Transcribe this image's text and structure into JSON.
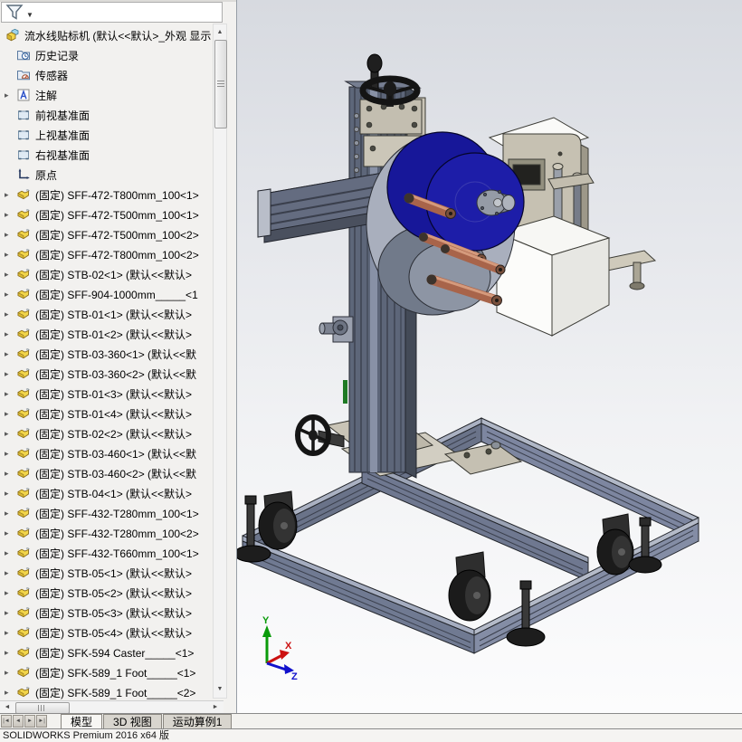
{
  "feature_tree": {
    "filter_tooltip": "过滤",
    "items": [
      {
        "icon": "assembly",
        "label": "流水线贴标机 (默认<<默认>_外观 显示",
        "indent": 0,
        "expandable": false
      },
      {
        "icon": "history",
        "label": "历史记录",
        "indent": 1,
        "expandable": false
      },
      {
        "icon": "sensor",
        "label": "传感器",
        "indent": 1,
        "expandable": false
      },
      {
        "icon": "annotation",
        "label": "注解",
        "indent": 1,
        "expandable": true
      },
      {
        "icon": "plane",
        "label": "前视基准面",
        "indent": 1,
        "expandable": false
      },
      {
        "icon": "plane",
        "label": "上视基准面",
        "indent": 1,
        "expandable": false
      },
      {
        "icon": "plane",
        "label": "右视基准面",
        "indent": 1,
        "expandable": false
      },
      {
        "icon": "origin",
        "label": "原点",
        "indent": 1,
        "expandable": false
      },
      {
        "icon": "part",
        "label": "(固定) SFF-472-T800mm_100<1>",
        "indent": 1,
        "expandable": true
      },
      {
        "icon": "part",
        "label": "(固定) SFF-472-T500mm_100<1>",
        "indent": 1,
        "expandable": true
      },
      {
        "icon": "part",
        "label": "(固定) SFF-472-T500mm_100<2>",
        "indent": 1,
        "expandable": true
      },
      {
        "icon": "part",
        "label": "(固定) SFF-472-T800mm_100<2>",
        "indent": 1,
        "expandable": true
      },
      {
        "icon": "part",
        "label": "(固定) STB-02<1> (默认<<默认>",
        "indent": 1,
        "expandable": true
      },
      {
        "icon": "part",
        "label": "(固定) SFF-904-1000mm_____<1",
        "indent": 1,
        "expandable": true
      },
      {
        "icon": "part",
        "label": "(固定) STB-01<1> (默认<<默认>",
        "indent": 1,
        "expandable": true
      },
      {
        "icon": "part",
        "label": "(固定) STB-01<2> (默认<<默认>",
        "indent": 1,
        "expandable": true
      },
      {
        "icon": "part",
        "label": "(固定) STB-03-360<1> (默认<<默",
        "indent": 1,
        "expandable": true
      },
      {
        "icon": "part",
        "label": "(固定) STB-03-360<2> (默认<<默",
        "indent": 1,
        "expandable": true
      },
      {
        "icon": "part",
        "label": "(固定) STB-01<3> (默认<<默认>",
        "indent": 1,
        "expandable": true
      },
      {
        "icon": "part",
        "label": "(固定) STB-01<4> (默认<<默认>",
        "indent": 1,
        "expandable": true
      },
      {
        "icon": "part",
        "label": "(固定) STB-02<2> (默认<<默认>",
        "indent": 1,
        "expandable": true
      },
      {
        "icon": "part",
        "label": "(固定) STB-03-460<1> (默认<<默",
        "indent": 1,
        "expandable": true
      },
      {
        "icon": "part",
        "label": "(固定) STB-03-460<2> (默认<<默",
        "indent": 1,
        "expandable": true
      },
      {
        "icon": "part",
        "label": "(固定) STB-04<1> (默认<<默认>",
        "indent": 1,
        "expandable": true
      },
      {
        "icon": "part",
        "label": "(固定) SFF-432-T280mm_100<1>",
        "indent": 1,
        "expandable": true
      },
      {
        "icon": "part",
        "label": "(固定) SFF-432-T280mm_100<2>",
        "indent": 1,
        "expandable": true
      },
      {
        "icon": "part",
        "label": "(固定) SFF-432-T660mm_100<1>",
        "indent": 1,
        "expandable": true
      },
      {
        "icon": "part",
        "label": "(固定) STB-05<1> (默认<<默认>",
        "indent": 1,
        "expandable": true
      },
      {
        "icon": "part",
        "label": "(固定) STB-05<2> (默认<<默认>",
        "indent": 1,
        "expandable": true
      },
      {
        "icon": "part",
        "label": "(固定) STB-05<3> (默认<<默认>",
        "indent": 1,
        "expandable": true
      },
      {
        "icon": "part",
        "label": "(固定) STB-05<4> (默认<<默认>",
        "indent": 1,
        "expandable": true
      },
      {
        "icon": "part",
        "label": "(固定) SFK-594 Caster_____<1>",
        "indent": 1,
        "expandable": true
      },
      {
        "icon": "part",
        "label": "(固定) SFK-589_1 Foot_____<1>",
        "indent": 1,
        "expandable": true
      },
      {
        "icon": "part",
        "label": "(固定) SFK-589_1 Foot_____<2>",
        "indent": 1,
        "expandable": true
      }
    ]
  },
  "viewport": {
    "triad": {
      "x_label": "X",
      "y_label": "Y",
      "z_label": "Z"
    }
  },
  "bottom_tabs": {
    "nav": [
      {
        "glyph": "|◄",
        "name": "first"
      },
      {
        "glyph": "◄",
        "name": "previous"
      },
      {
        "glyph": "►",
        "name": "next"
      },
      {
        "glyph": "►|",
        "name": "last"
      }
    ],
    "items": [
      {
        "label": "模型",
        "active": true
      },
      {
        "label": "3D 视图",
        "active": false
      },
      {
        "label": "运动算例1",
        "active": false
      }
    ]
  },
  "status_bar": {
    "text": "SOLIDWORKS Premium 2016 x64 版"
  },
  "colors": {
    "reel_blue": "#1d1da8",
    "copper_roller": "#a8644a",
    "frame_gray": "#7d86a0",
    "machine_beige": "#c6c1b2",
    "part_icon_yellow": "#f2d549",
    "triad_x_red": "#cc1111",
    "triad_y_green": "#0a9b0a",
    "triad_z_blue": "#1111cc",
    "viewport_top": "#d7dae0",
    "viewport_bottom": "#fcfcfd"
  }
}
